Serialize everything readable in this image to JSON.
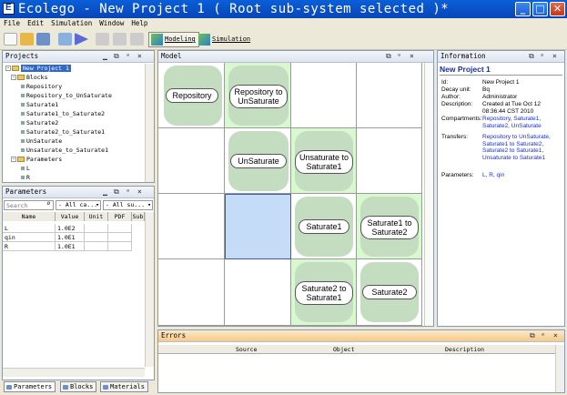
{
  "window": {
    "title": "Ecolego - New Project 1 ( Root sub-system selected )*"
  },
  "menu": [
    "File",
    "Edit",
    "Simulation",
    "Window",
    "Help"
  ],
  "toolbar": {
    "modeling_label": "Modeling",
    "simulation_label": "Simulation"
  },
  "projects": {
    "title": "Projects",
    "tree": {
      "root": "New Project 1",
      "blocks_label": "Blocks",
      "blocks": [
        "Repository",
        "Repository_to_UnSaturate",
        "Saturate1",
        "Saturate1_to_Saturate2",
        "Saturate2",
        "Saturate2_to_Saturate1",
        "UnSaturate",
        "Unsaturate_to_Saturate1"
      ],
      "parameters_label": "Parameters",
      "parameters": [
        "L",
        "R"
      ]
    }
  },
  "parameters_panel": {
    "title": "Parameters",
    "search_placeholder": "Search",
    "filter1": "- All ca...",
    "filter2": "- All su...",
    "columns": [
      "Name",
      "Value",
      "Unit",
      "PDF",
      "Sub"
    ],
    "rows": [
      {
        "name": "L",
        "value": "1.0E2"
      },
      {
        "name": "qin",
        "value": "1.0E1"
      },
      {
        "name": "R",
        "value": "1.0E1"
      }
    ]
  },
  "bottom_tabs": [
    "Parameters",
    "Blocks",
    "Materials"
  ],
  "model": {
    "title": "Model",
    "nodes": {
      "repository": "Repository",
      "repo_to_unsat": "Repository to UnSaturate",
      "unsaturate": "UnSaturate",
      "unsat_to_sat1": "Unsaturate to Saturate1",
      "saturate1": "Saturate1",
      "sat1_to_sat2": "Saturate1 to Saturate2",
      "sat2_to_sat1": "Saturate2 to Saturate1",
      "saturate2": "Saturate2"
    }
  },
  "information": {
    "title": "Information",
    "heading": "New Project 1",
    "fields": [
      {
        "key": "Id:",
        "value": "New Project 1"
      },
      {
        "key": "Decay unit:",
        "value": "Bq"
      },
      {
        "key": "Author:",
        "value": "Administrator"
      },
      {
        "key": "Description:",
        "value": "Created at Tue Oct 12 08:36:44 CST 2010"
      },
      {
        "key": "Compartments:",
        "value": "Repository, Saturate1, Saturate2, UnSaturate"
      },
      {
        "key": "Transfers:",
        "value": "Repository to UnSaturate, Saturate1 to Saturate2, Saturate2 to Saturate1, Unsaturate to Saturate1"
      },
      {
        "key": "Parameters:",
        "value": "L, R, qin"
      }
    ]
  },
  "errors": {
    "title": "Errors",
    "columns": [
      "Source",
      "Object",
      "Description"
    ]
  },
  "colors": {
    "titlebar": "#0a5fd8",
    "transfer_cell": "#d8f8d0",
    "selected_cell": "#c4dcf8",
    "link": "#1a2fd0"
  }
}
